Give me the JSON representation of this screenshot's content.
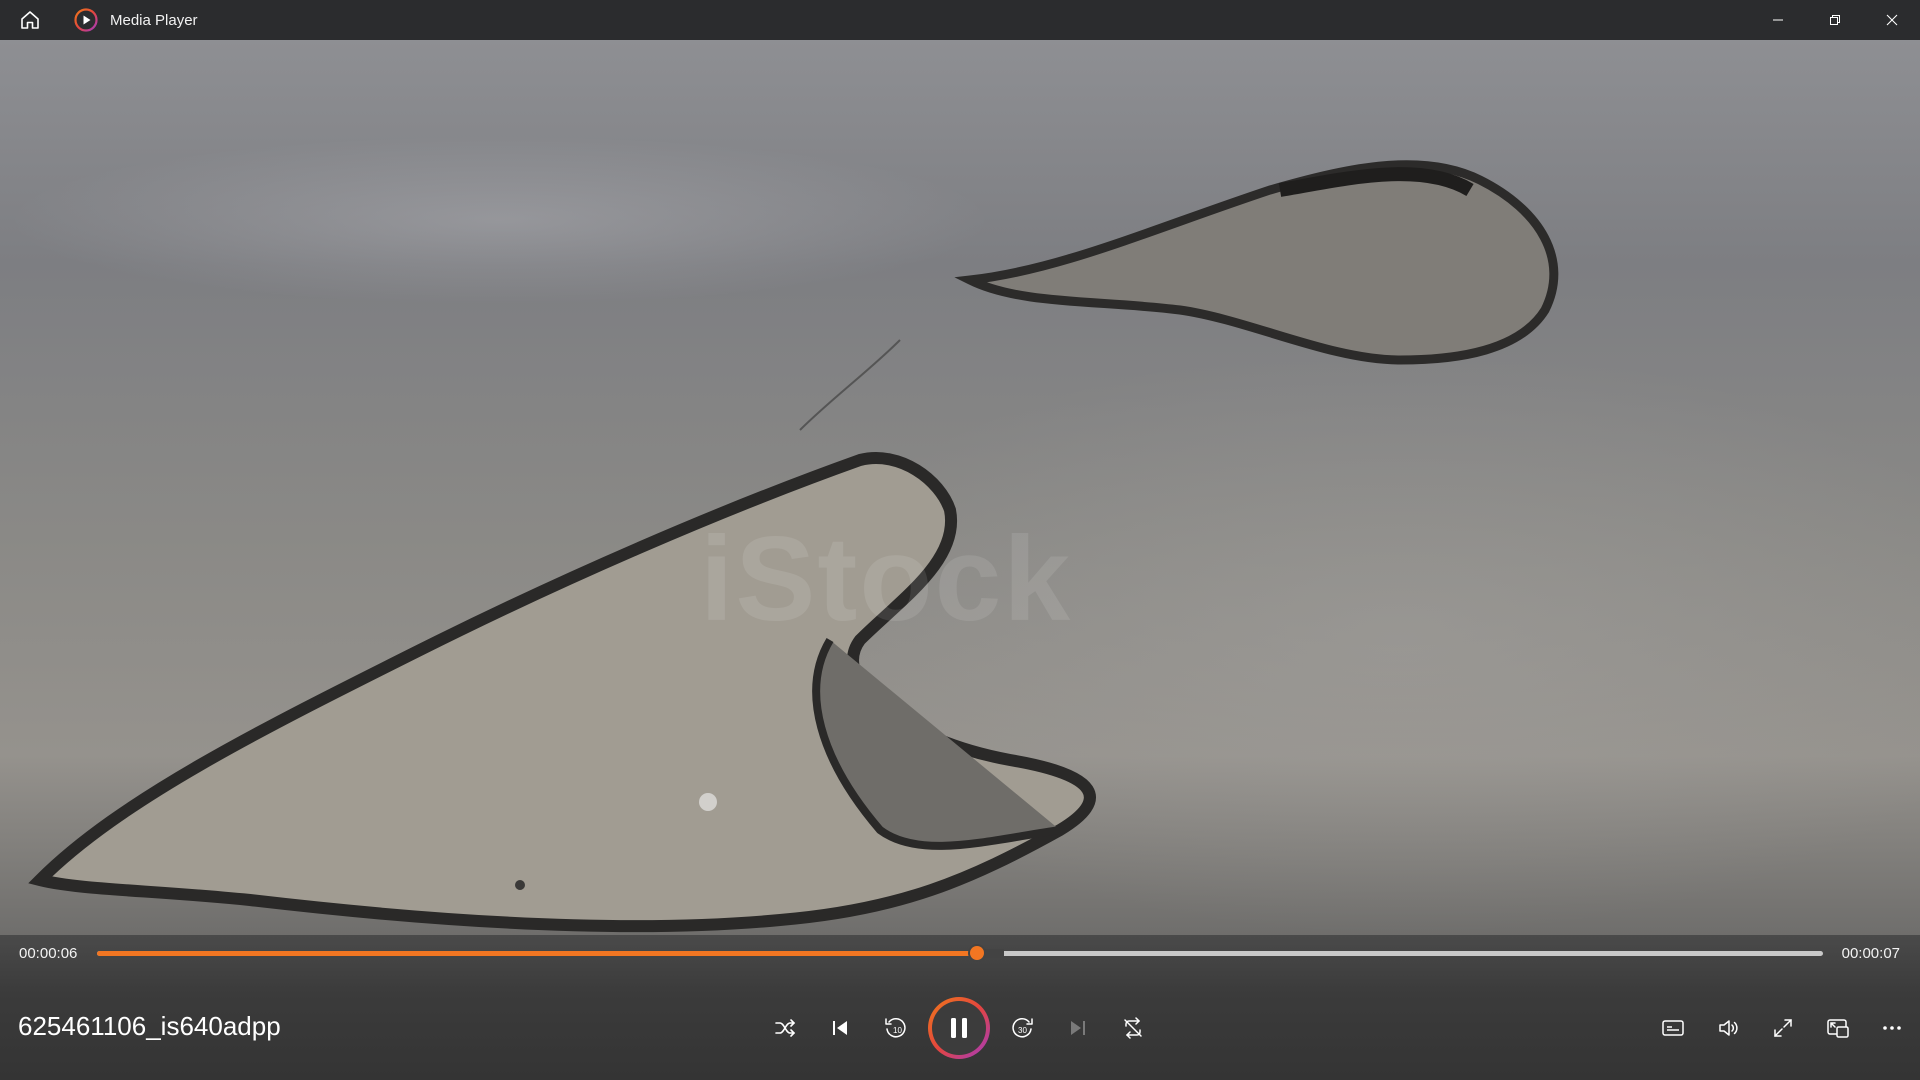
{
  "titlebar": {
    "title": "Media Player",
    "home_icon": "home-icon",
    "app_icon": "media-player-logo-icon",
    "accent": "#f27622"
  },
  "window_controls": [
    "minimize-icon",
    "restore-icon",
    "close-icon"
  ],
  "playback": {
    "current_time": "00:00:06",
    "total_time": "00:00:07",
    "progress": 0.51,
    "state": "playing"
  },
  "media": {
    "title": "625461106_is640adpp"
  },
  "controls": {
    "center": [
      "shuffle-icon",
      "previous-icon",
      "skip-back-10-icon",
      "pause-icon",
      "skip-forward-30-icon",
      "next-icon",
      "repeat-off-icon"
    ],
    "right": [
      "captions-icon",
      "volume-icon",
      "fullscreen-icon",
      "mini-player-icon",
      "more-options-icon"
    ],
    "skip_back_label": "10",
    "skip_forward_label": "30"
  },
  "colors": {
    "accent": "#f27622",
    "titlebar_bg": "#2b2c2e",
    "controls_bg": "#3b3b3b"
  }
}
